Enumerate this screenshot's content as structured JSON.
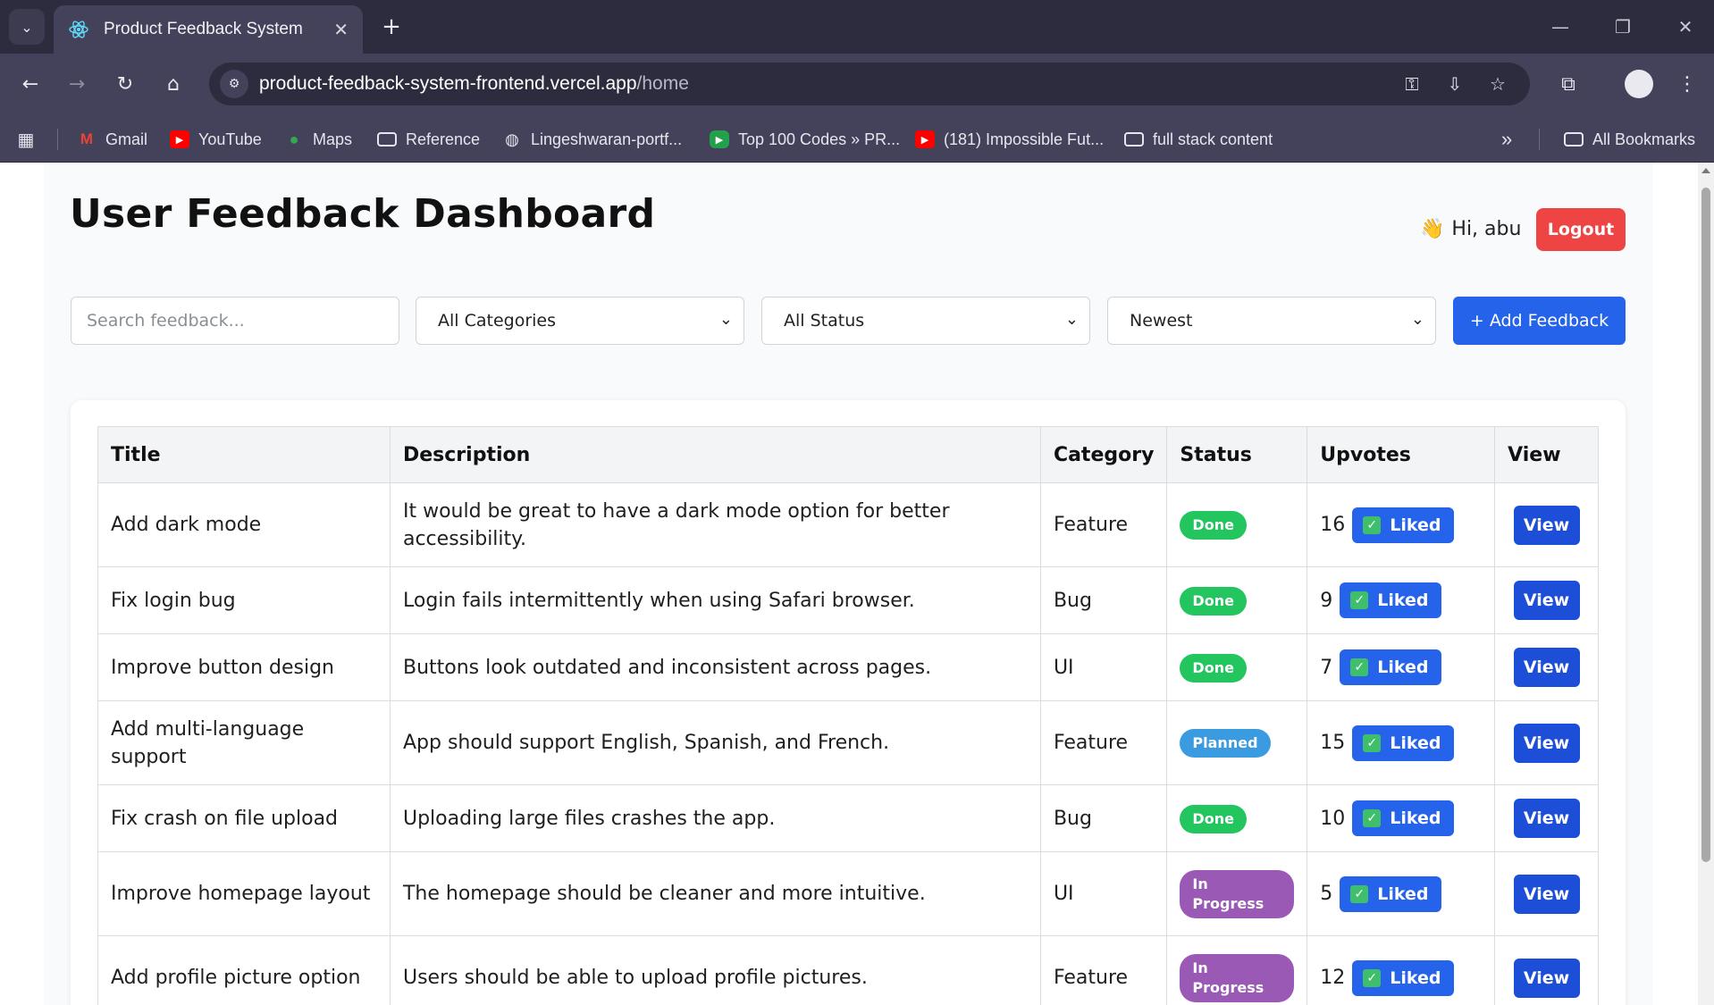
{
  "browser": {
    "tab_title": "Product Feedback System",
    "url_host": "product-feedback-system-frontend.vercel.app",
    "url_path": "/home",
    "bookmarks": [
      {
        "label": "Gmail",
        "icon": "gmail-icon"
      },
      {
        "label": "YouTube",
        "icon": "youtube-icon"
      },
      {
        "label": "Maps",
        "icon": "maps-icon"
      },
      {
        "label": "Reference",
        "icon": "folder-icon"
      },
      {
        "label": "Lingeshwaran-portf...",
        "icon": "globe-icon"
      },
      {
        "label": "Top 100 Codes » PR...",
        "icon": "shield-icon"
      },
      {
        "label": "(181) Impossible Fut...",
        "icon": "youtube-icon"
      },
      {
        "label": "full stack content",
        "icon": "folder-icon"
      }
    ],
    "all_bookmarks": "All Bookmarks"
  },
  "header": {
    "title": "User Feedback Dashboard",
    "greeting": "Hi, abu",
    "greeting_emoji": "👋",
    "logout_label": "Logout"
  },
  "filters": {
    "search_placeholder": "Search feedback...",
    "category": "All Categories",
    "status": "All Status",
    "sort": "Newest",
    "add_label": "+ Add Feedback"
  },
  "table": {
    "headers": [
      "Title",
      "Description",
      "Category",
      "Status",
      "Upvotes",
      "View"
    ],
    "liked_label": "Liked",
    "view_label": "View",
    "rows": [
      {
        "title": "Add dark mode",
        "description": "It would be great to have a dark mode option for better accessibility.",
        "category": "Feature",
        "status": "Done",
        "upvotes": "16"
      },
      {
        "title": "Fix login bug",
        "description": "Login fails intermittently when using Safari browser.",
        "category": "Bug",
        "status": "Done",
        "upvotes": "9"
      },
      {
        "title": "Improve button design",
        "description": "Buttons look outdated and inconsistent across pages.",
        "category": "UI",
        "status": "Done",
        "upvotes": "7"
      },
      {
        "title": "Add multi-language support",
        "description": "App should support English, Spanish, and French.",
        "category": "Feature",
        "status": "Planned",
        "upvotes": "15"
      },
      {
        "title": "Fix crash on file upload",
        "description": "Uploading large files crashes the app.",
        "category": "Bug",
        "status": "Done",
        "upvotes": "10"
      },
      {
        "title": "Improve homepage layout",
        "description": "The homepage should be cleaner and more intuitive.",
        "category": "UI",
        "status": "In Progress",
        "upvotes": "5"
      },
      {
        "title": "Add profile picture option",
        "description": "Users should be able to upload profile pictures.",
        "category": "Feature",
        "status": "In Progress",
        "upvotes": "12"
      }
    ]
  },
  "colors": {
    "done": "#22c55e",
    "planned": "#3b9be0",
    "in_progress": "#9b59b6",
    "primary": "#2563eb",
    "danger": "#ef4444"
  }
}
